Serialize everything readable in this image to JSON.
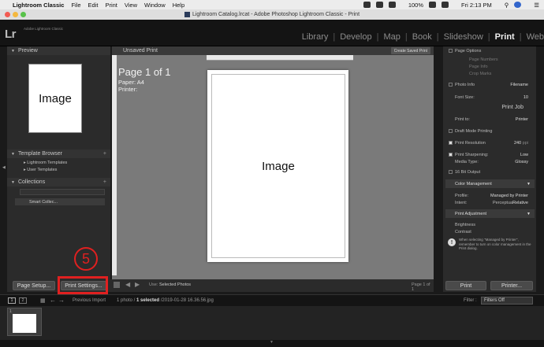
{
  "menubar": {
    "app": "Lightroom Classic",
    "menus": [
      "File",
      "Edit",
      "Print",
      "View",
      "Window",
      "Help"
    ],
    "battery": "100%",
    "clock": "Fri 2:13 PM"
  },
  "window": {
    "title": "Lightroom Catalog.lrcat - Adobe Photoshop Lightroom Classic - Print"
  },
  "identity": {
    "logo": "Lr",
    "sub1": "Adobe Lightroom Classic"
  },
  "modules": {
    "library": "Library",
    "develop": "Develop",
    "map": "Map",
    "book": "Book",
    "slideshow": "Slideshow",
    "print": "Print",
    "web": "Web",
    "sep": "|"
  },
  "left": {
    "preview_title": "Preview",
    "preview_image": "Image",
    "template_title": "Template Browser",
    "templates": [
      "Lightroom Templates",
      "User Templates"
    ],
    "collections_title": "Collections",
    "smart_collection": "Smart Collec..."
  },
  "center": {
    "doc_title": "Unsaved Print",
    "create_saved": "Create Saved Print",
    "page_label": "Page 1 of 1",
    "paper": "Paper: A4",
    "printer": "Printer:",
    "image": "Image"
  },
  "right": {
    "page_options": "Page Options",
    "page_numbers": "Page Numbers",
    "page_info": "Page Info",
    "crop_marks": "Crop Marks",
    "photo_info": "Photo Info",
    "photo_info_val": "Filename",
    "font_size": "Font Size:",
    "font_size_val": "10",
    "print_job": "Print Job",
    "print_to": "Print to:",
    "print_to_val": "Printer",
    "draft": "Draft Mode Printing",
    "resolution": "Print Resolution",
    "resolution_val": "240",
    "resolution_unit": "ppi",
    "sharpening": "Print Sharpening:",
    "sharpening_val": "Low",
    "media": "Media Type:",
    "media_val": "Glossy",
    "bit16": "16 Bit Output",
    "color_mgmt": "Color Management",
    "profile": "Profile:",
    "profile_val": "Managed by Printer",
    "intent": "Intent:",
    "intent_a": "Perceptual",
    "intent_b": "Relative",
    "adjust": "Print Adjustment",
    "brightness": "Brightness",
    "contrast": "Contrast",
    "note": "When selecting \"Managed by Printer\", remember to turn on color management in the Print dialog."
  },
  "toolbar": {
    "page_setup": "Page Setup...",
    "print_settings": "Print Settings...",
    "use": "Use:",
    "use_val": "Selected Photos",
    "page_count": "Page 1 of 1",
    "print": "Print",
    "printer": "Printer..."
  },
  "callout": {
    "number": "5"
  },
  "filmstrip": {
    "nav1": "1",
    "nav2": "2",
    "source": "Previous Import",
    "info": "1 photo /",
    "selected": "1 selected",
    "filename": "/2019-01-28 16.36.56.jpg",
    "filter": "Filter :",
    "filter_val": "Filters Off",
    "thumb_index": "1"
  },
  "colors": {
    "accent": "#e02020",
    "panel": "#2b2b2b",
    "canvas": "#7a7a7a"
  }
}
